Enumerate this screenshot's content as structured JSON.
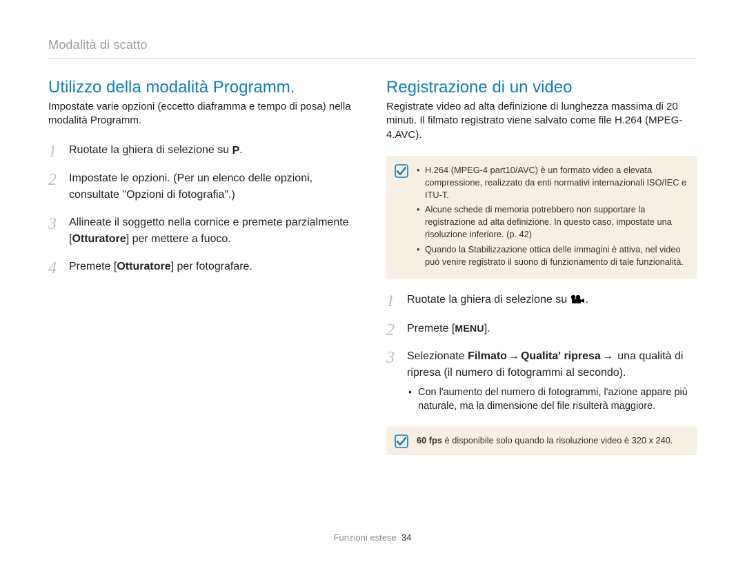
{
  "breadcrumb": "Modalità di scatto",
  "left": {
    "heading": "Utilizzo della modalità Programm.",
    "intro": "Impostate varie opzioni (eccetto diaframma e tempo di posa) nella modalità Programm.",
    "steps": {
      "s1_pre": "Ruotate la ghiera di selezione su ",
      "s1_icon_label": "P",
      "s1_post": ".",
      "s2": "Impostate le opzioni. (Per un elenco delle opzioni, consultate \"Opzioni di fotografia\".)",
      "s3_pre": "Allineate il soggetto nella cornice e premete parzialmente [",
      "s3_bold": "Otturatore",
      "s3_post": "] per mettere a fuoco.",
      "s4_pre": "Premete [",
      "s4_bold": "Otturatore",
      "s4_post": "] per fotografare."
    }
  },
  "right": {
    "heading": "Registrazione di un video",
    "intro": "Registrate video ad alta definizione di lunghezza massima di 20 minuti. Il filmato registrato viene salvato come file H.264 (MPEG-4.AVC).",
    "notes1": [
      "H.264 (MPEG-4 part10/AVC) è un formato video a elevata compressione, realizzato da enti normativi internazionali ISO/IEC e ITU-T.",
      "Alcune schede di memoria potrebbero non supportare la registrazione ad alta definizione. In questo caso, impostate una risoluzione inferiore. (p. 42)",
      "Quando la Stabilizzazione ottica delle immagini è attiva, nel video può venire registrato il suono di funzionamento di tale funzionalità."
    ],
    "steps": {
      "s1_pre": "Ruotate la ghiera di selezione su ",
      "s1_post": ".",
      "s2_pre": "Premete [",
      "s2_bold": "MENU",
      "s2_post": "].",
      "s3_pre": "Selezionate ",
      "s3_b1": "Filmato",
      "s3_arrow": "→",
      "s3_b2": "Qualita' ripresa",
      "s3_post": " una qualità di ripresa (il numero di fotogrammi al secondo).",
      "s3_sub": "Con l'aumento del numero di fotogrammi, l'azione appare più naturale, ma la dimensione del file risulterà maggiore."
    },
    "note2_bold": "60 fps",
    "note2_rest": " è disponibile solo quando la risoluzione video è 320 x 240."
  },
  "footer": {
    "label": "Funzioni estese",
    "page": "34"
  }
}
